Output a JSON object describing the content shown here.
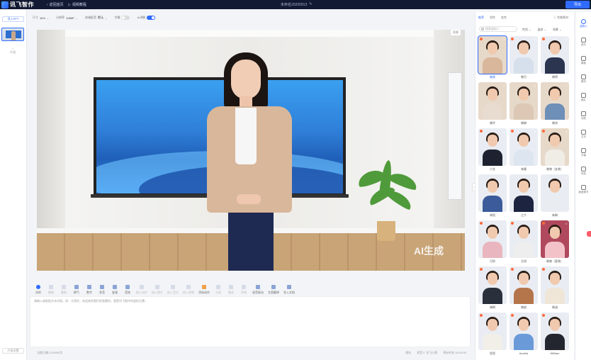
{
  "topbar": {
    "logo_text": "讯飞智作",
    "back_home": "返回首页",
    "video_tutorial": "视频教程",
    "doc_title": "未命名20200913",
    "export_label": "导出"
  },
  "left_panel": {
    "import_ppt": "导入PPT",
    "add_scene": "+",
    "add_scene_label": "片段",
    "bottom_btn": "片段设置"
  },
  "toolbar": {
    "ratio_label": "尺寸",
    "ratio_value": "16:9",
    "resolution_label": "分辨率",
    "resolution_value": "1080P",
    "rate_label": "前端配音",
    "rate_value": "默认",
    "subtitle_label": "字幕",
    "ai_label": "AI讲解"
  },
  "canvas": {
    "ai_watermark": "AI生成",
    "tag": "背景"
  },
  "editor": {
    "tools": [
      {
        "label": "试听",
        "style": "blue-round"
      },
      {
        "label": "撤销",
        "style": "dim"
      },
      {
        "label": "重做",
        "style": "dim"
      },
      {
        "label": "换气",
        "style": ""
      },
      {
        "label": "数字",
        "style": ""
      },
      {
        "label": "多音",
        "style": ""
      },
      {
        "label": "变速",
        "style": ""
      },
      {
        "label": "音效",
        "style": ""
      },
      {
        "label": "插入动作",
        "style": "dim"
      },
      {
        "label": "插入图片",
        "style": "dim"
      },
      {
        "label": "插入音乐",
        "style": "dim"
      },
      {
        "label": "插入视频",
        "style": "dim"
      },
      {
        "label": "添加动作",
        "style": "orange"
      },
      {
        "label": "分段",
        "style": "dim"
      },
      {
        "label": "重读",
        "style": "dim"
      },
      {
        "label": "停顿",
        "style": "dim"
      },
      {
        "label": "录音驱动",
        "style": ""
      },
      {
        "label": "文案翻译",
        "style": ""
      },
      {
        "label": "导入文档",
        "style": ""
      }
    ],
    "hint": "请输入或粘贴文本内容。如：大家好，欢迎来到我们的直播间，我是讯飞智作的虚拟主播...",
    "footer_placeholder": "当前已输入0/5000字",
    "footer_items": [
      "保存",
      "发音人 讯飞小燕",
      "预计时长 00:00:00"
    ]
  },
  "right_panel": {
    "tabs": [
      "推荐",
      "男性",
      "女性"
    ],
    "active_tab": 0,
    "right_link": "完善素材",
    "search_placeholder": "搜索虚拟人",
    "filters": [
      "性别",
      "姿态",
      "场景"
    ],
    "avatars": [
      {
        "name": "晓燕",
        "tone": "warm",
        "flame": true,
        "selected": true,
        "body": "#d8b79b"
      },
      {
        "name": "晓月",
        "tone": "",
        "flame": true,
        "selected": false,
        "body": "#d6e0ec"
      },
      {
        "name": "晓明",
        "tone": "",
        "flame": true,
        "selected": false,
        "body": "#2b3550"
      },
      {
        "name": "晓玲",
        "tone": "warm",
        "flame": false,
        "selected": false,
        "body": "#e8dcd0"
      },
      {
        "name": "晓琳",
        "tone": "warm",
        "flame": false,
        "selected": false,
        "body": "#dcc8b4"
      },
      {
        "name": "晓伟",
        "tone": "warm",
        "flame": false,
        "selected": false,
        "body": "#6d8fb8"
      },
      {
        "name": "小艺",
        "tone": "",
        "flame": true,
        "selected": false,
        "body": "#1e2230"
      },
      {
        "name": "林晨",
        "tone": "",
        "flame": true,
        "selected": false,
        "body": "#dde6f0"
      },
      {
        "name": "晓晓（女装）",
        "tone": "warm",
        "flame": true,
        "selected": false,
        "body": "#f0ece6"
      },
      {
        "name": "林阳",
        "tone": "",
        "flame": false,
        "selected": false,
        "body": "#3b5b9a"
      },
      {
        "name": "江宁",
        "tone": "",
        "flame": false,
        "selected": false,
        "body": "#1c2440"
      },
      {
        "name": "林琳",
        "tone": "",
        "flame": false,
        "selected": false,
        "body": "#e9ecf1"
      },
      {
        "name": "可欣",
        "tone": "",
        "flame": true,
        "selected": false,
        "body": "#e9b6bf"
      },
      {
        "name": "芷妍",
        "tone": "",
        "flame": true,
        "selected": false,
        "body": "#eeeeee"
      },
      {
        "name": "晓晓（夏装）",
        "tone": "pink",
        "flame": true,
        "selected": false,
        "body": "#f3c2c8"
      },
      {
        "name": "晓桐",
        "tone": "",
        "flame": true,
        "selected": false,
        "body": "#2a2f3c"
      },
      {
        "name": "晓俊",
        "tone": "",
        "flame": true,
        "selected": false,
        "body": "#b5754a"
      },
      {
        "name": "晓涵",
        "tone": "",
        "flame": true,
        "selected": false,
        "body": "#efe6d8"
      },
      {
        "name": "思思",
        "tone": "",
        "flame": true,
        "selected": false,
        "body": "#f2efe9"
      },
      {
        "name": "Aurelia",
        "tone": "",
        "flame": true,
        "selected": false,
        "body": "#6a9ad8"
      },
      {
        "name": "William",
        "tone": "",
        "flame": true,
        "selected": false,
        "body": "#23262e"
      }
    ]
  },
  "rail": {
    "items": [
      {
        "label": "虚拟人",
        "active": true
      },
      {
        "label": "音乐",
        "active": false
      },
      {
        "label": "模板",
        "active": false
      },
      {
        "label": "素材",
        "active": false
      },
      {
        "label": "图片",
        "active": false
      },
      {
        "label": "动效",
        "active": false
      },
      {
        "label": "文字",
        "active": false
      },
      {
        "label": "字幕",
        "active": false
      },
      {
        "label": "特效",
        "active": false
      },
      {
        "label": "画面调节",
        "active": false
      }
    ]
  }
}
